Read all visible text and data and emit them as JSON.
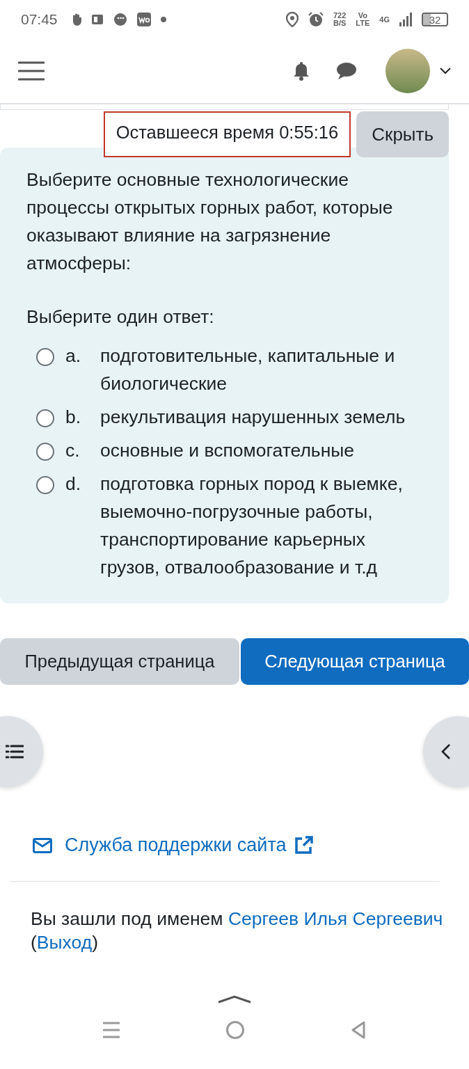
{
  "status_bar": {
    "time": "07:45",
    "net_speed": "722",
    "net_speed_unit": "B/S",
    "volte": "Vo",
    "volte_sub": "LTE",
    "network": "4G",
    "battery": "32"
  },
  "timer": {
    "label": "Оставшееся время 0:55:16"
  },
  "hide_button": "Скрыть",
  "question": {
    "text": "Выберите основные технологические процессы открытых горных работ, которые оказывают влияние на загрязнение атмосферы:",
    "prompt": "Выберите один ответ:",
    "options": [
      {
        "letter": "a.",
        "text": "подготовительные, капитальные и биологические",
        "selected": false
      },
      {
        "letter": "b.",
        "text": "рекультивация нарушенных земель",
        "selected": false
      },
      {
        "letter": "c.",
        "text": "основные и вспомогательные",
        "selected": false
      },
      {
        "letter": "d.",
        "text": "подготовка горных пород к выемке, выемочно-погрузочные работы, транспортирование карьерных грузов, отвалообразование и т.д",
        "selected": false
      }
    ]
  },
  "navigation": {
    "previous": "Предыдущая страница",
    "next": "Следующая страница"
  },
  "support_link": "Служба поддержки сайта",
  "footer": {
    "prefix": "Вы зашли под именем",
    "user": "Сергеев Илья Сергеевич",
    "logout_before": "(",
    "logout": "Выход",
    "logout_after": ")"
  }
}
